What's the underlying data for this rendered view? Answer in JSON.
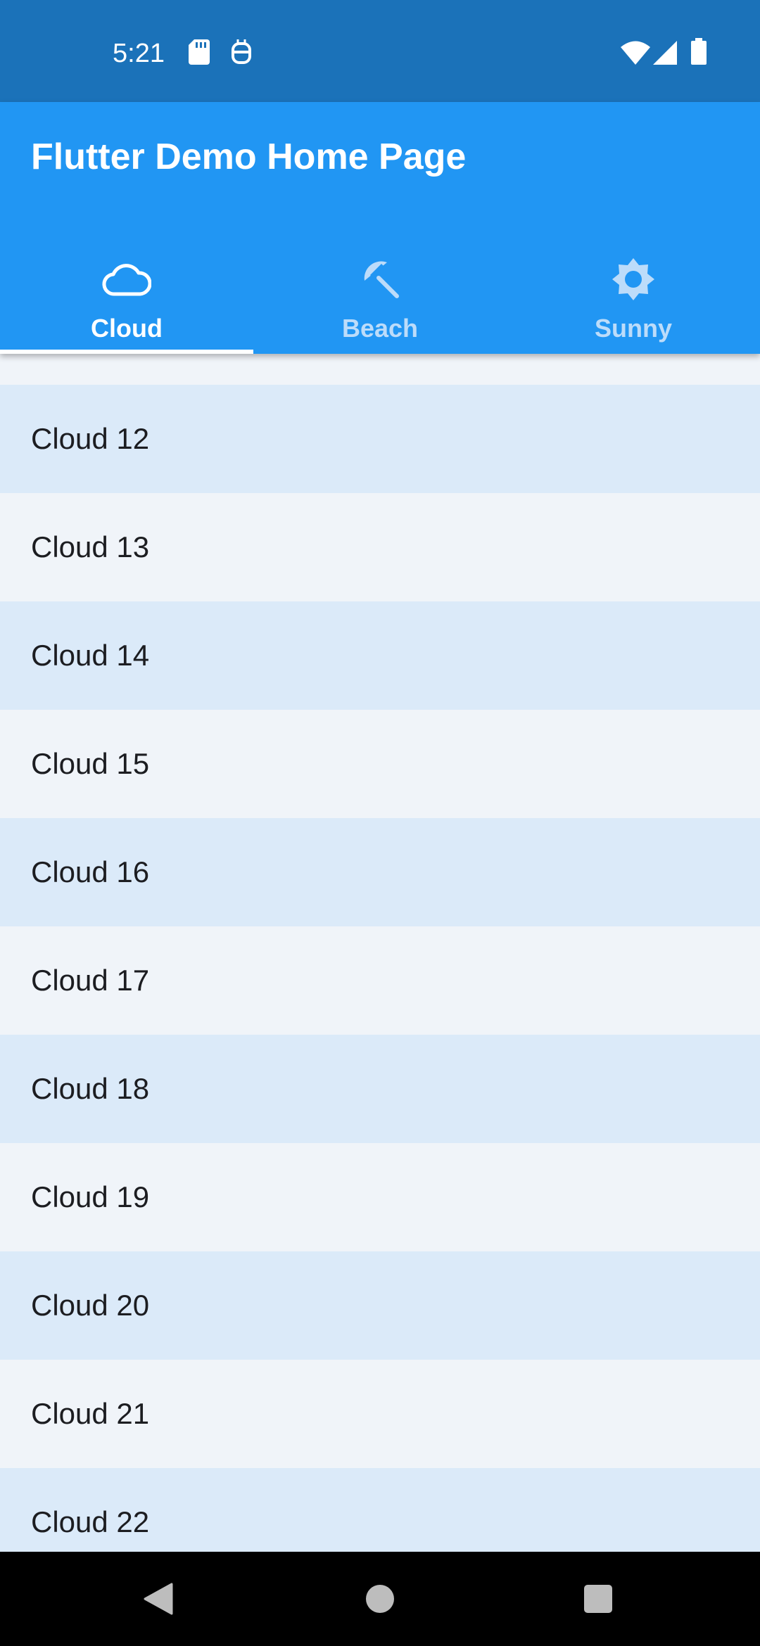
{
  "status_bar": {
    "time": "5:21",
    "icons": [
      "sd-card-icon",
      "android-debug-icon",
      "wifi-icon",
      "signal-icon",
      "battery-icon"
    ]
  },
  "app_bar": {
    "title": "Flutter Demo Home Page",
    "background": "#2196f3"
  },
  "tabs": [
    {
      "label": "Cloud",
      "icon": "cloud-icon",
      "active": true
    },
    {
      "label": "Beach",
      "icon": "beach-access-icon",
      "active": false
    },
    {
      "label": "Sunny",
      "icon": "sunny-icon",
      "active": false
    }
  ],
  "list": {
    "items": [
      "Cloud 12",
      "Cloud 13",
      "Cloud 14",
      "Cloud 15",
      "Cloud 16",
      "Cloud 17",
      "Cloud 18",
      "Cloud 19",
      "Cloud 20",
      "Cloud 21",
      "Cloud 22"
    ],
    "colors": {
      "odd": "#dbeaf9",
      "even": "#f0f4f9"
    }
  },
  "nav_bar": {
    "buttons": [
      "back-icon",
      "home-icon",
      "recents-icon"
    ]
  }
}
